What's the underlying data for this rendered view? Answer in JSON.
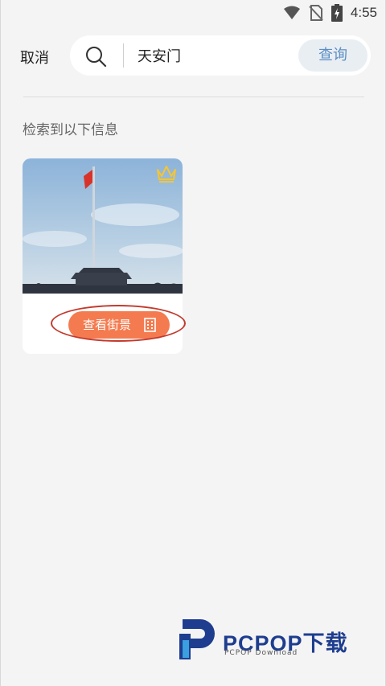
{
  "status_bar": {
    "time": "4:55",
    "icons": [
      "wifi-icon",
      "no-sim-icon",
      "battery-charging-icon"
    ]
  },
  "search": {
    "cancel_label": "取消",
    "query_value": "天安门",
    "query_button": "查询"
  },
  "results": {
    "heading": "检索到以下信息",
    "card": {
      "button_label": "查看街景",
      "badge_icon": "crown-icon",
      "image": "tiananmen-flagpole-photo"
    }
  },
  "watermark": {
    "title": "PCPOP下载",
    "subtitle": "PCPOP Download"
  },
  "colors": {
    "accent": "#f47b4f",
    "query_text": "#5a8ec4",
    "highlight": "#c33a2e",
    "crown": "#f5c531"
  }
}
